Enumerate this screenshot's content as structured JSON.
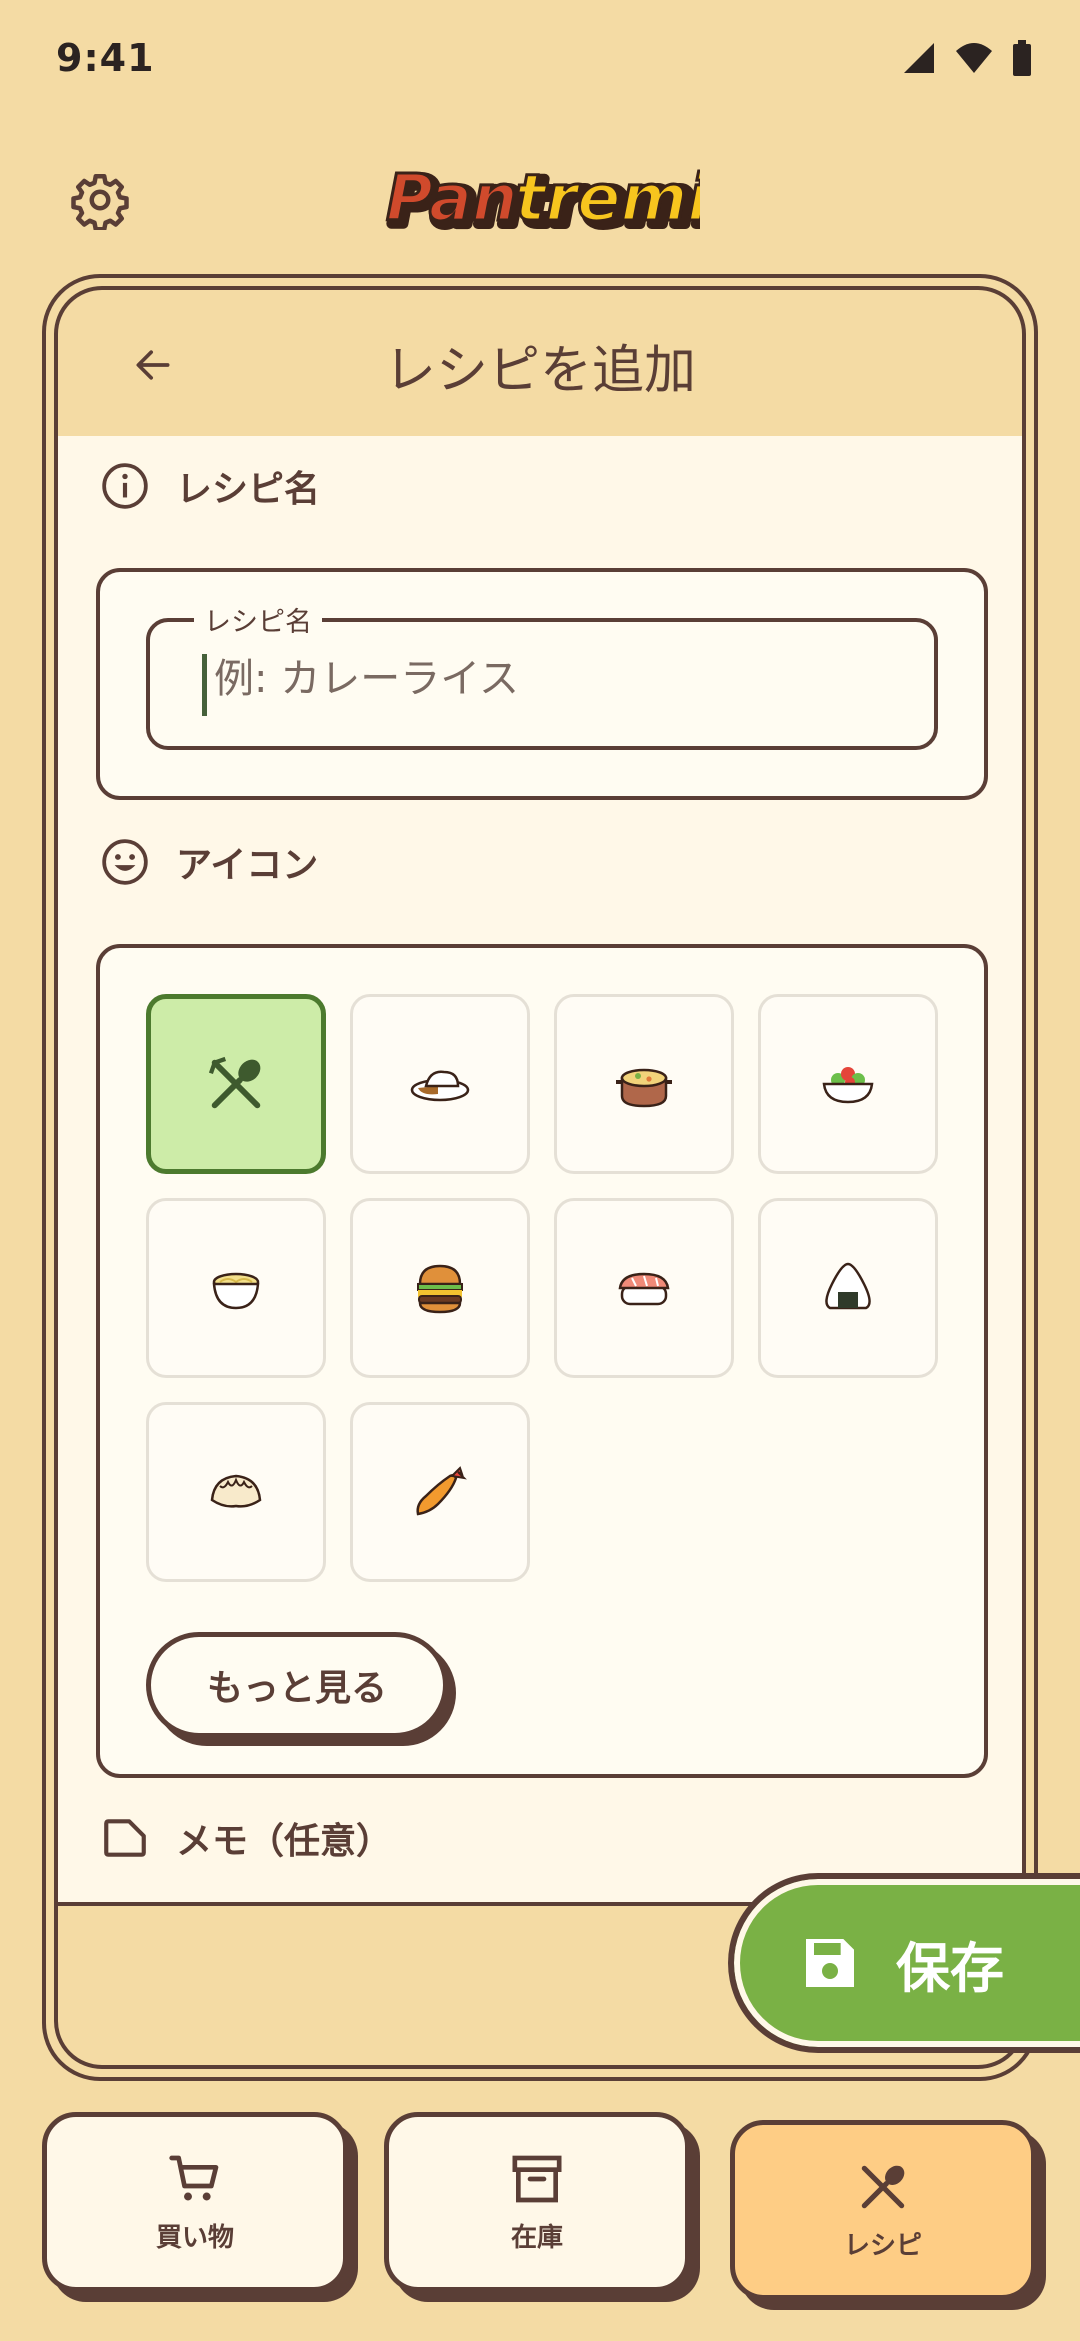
{
  "status_bar": {
    "time": "9:41"
  },
  "header": {
    "logo_text": "Pantremix"
  },
  "card": {
    "title": "レシピを追加"
  },
  "recipe_name_section": {
    "label": "レシピ名",
    "field_label": "レシピ名",
    "placeholder": "例: カレーライス",
    "value": ""
  },
  "icon_section": {
    "label": "アイコン",
    "icons": [
      "fork-and-spoon",
      "curry-rice",
      "stew",
      "salad",
      "ramen",
      "hamburger",
      "sushi",
      "onigiri",
      "gyoza",
      "fried-shrimp"
    ],
    "selected": "fork-and-spoon",
    "more_label": "もっと見る"
  },
  "memo_section": {
    "label": "メモ（任意）"
  },
  "save_button": {
    "label": "保存"
  },
  "bottom_nav": {
    "items": [
      {
        "label": "買い物",
        "icon": "cart-icon"
      },
      {
        "label": "在庫",
        "icon": "archive-icon"
      },
      {
        "label": "レシピ",
        "icon": "fork-spoon-icon"
      }
    ],
    "active": "レシピ"
  },
  "colors": {
    "background": "#f4dba4",
    "outline": "#5a3e36",
    "content_bg": "#fff8e8",
    "selected_bg": "#cdeca8",
    "selected_border": "#4c7a2e",
    "save_green": "#7ab145",
    "active_nav": "#fecd85",
    "logo_red": "#d04a2c",
    "logo_yellow": "#f7c51e"
  }
}
